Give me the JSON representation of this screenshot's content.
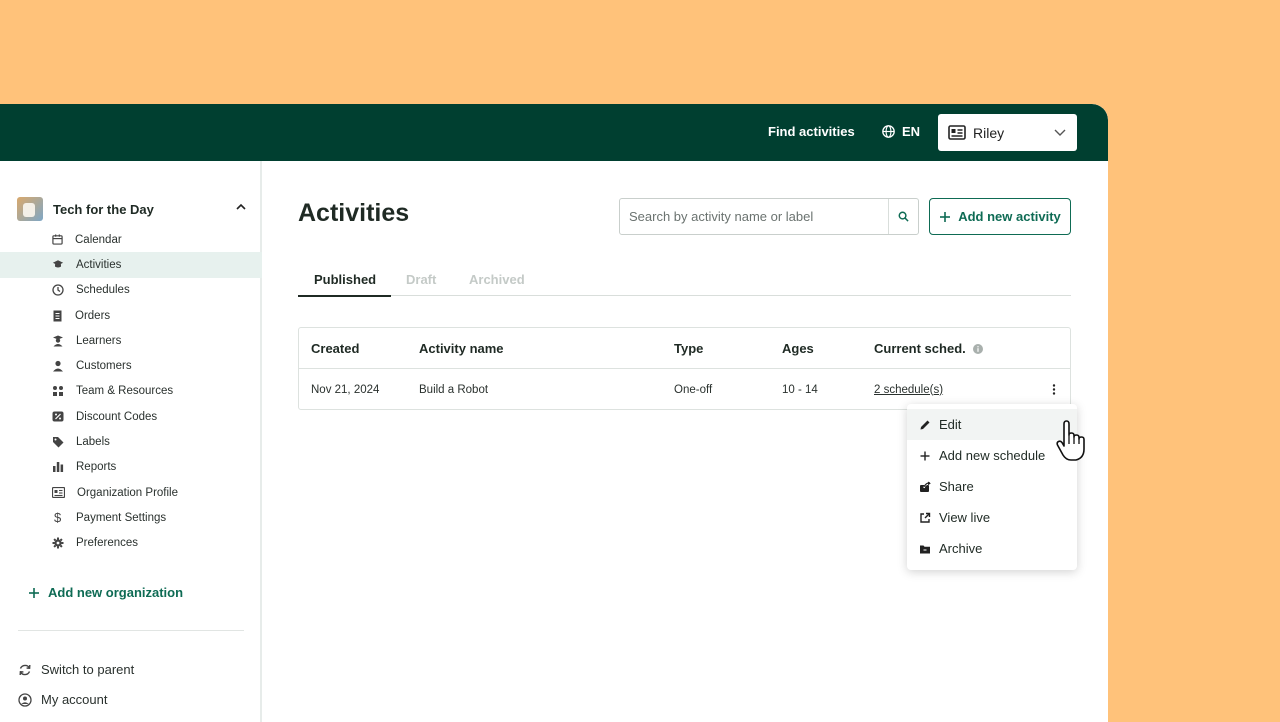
{
  "topbar": {
    "find_activities": "Find activities",
    "language": "EN",
    "user_name": "Riley"
  },
  "sidebar": {
    "org_name": "Tech for the Day",
    "items": [
      {
        "label": "Calendar",
        "icon": "calendar-icon"
      },
      {
        "label": "Activities",
        "icon": "graduation-cap-icon",
        "active": true
      },
      {
        "label": "Schedules",
        "icon": "clock-icon"
      },
      {
        "label": "Orders",
        "icon": "receipt-icon"
      },
      {
        "label": "Learners",
        "icon": "learner-icon"
      },
      {
        "label": "Customers",
        "icon": "person-icon"
      },
      {
        "label": "Team & Resources",
        "icon": "team-icon"
      },
      {
        "label": "Discount Codes",
        "icon": "discount-icon"
      },
      {
        "label": "Labels",
        "icon": "tag-icon"
      },
      {
        "label": "Reports",
        "icon": "bar-chart-icon"
      },
      {
        "label": "Organization Profile",
        "icon": "id-card-icon"
      },
      {
        "label": "Payment Settings",
        "icon": "dollar-icon"
      },
      {
        "label": "Preferences",
        "icon": "gear-icon"
      }
    ],
    "add_org": "Add new organization",
    "switch_parent": "Switch to parent",
    "my_account": "My account"
  },
  "main": {
    "title": "Activities",
    "search_placeholder": "Search by activity name or label",
    "add_button": "Add new activity",
    "tabs": [
      "Published",
      "Draft",
      "Archived"
    ],
    "table": {
      "headers": [
        "Created",
        "Activity name",
        "Type",
        "Ages",
        "Current sched."
      ],
      "rows": [
        {
          "created": "Nov 21, 2024",
          "name": "Build a Robot",
          "type": "One-off",
          "ages": "10 - 14",
          "schedule": "2 schedule(s)"
        }
      ]
    }
  },
  "menu": {
    "items": [
      "Edit",
      "Add new schedule",
      "Share",
      "View live",
      "Archive"
    ]
  },
  "colors": {
    "topbar": "#003F30",
    "accent": "#0E6B54",
    "background": "#FFC27A",
    "active_nav": "#E7F1EE"
  }
}
